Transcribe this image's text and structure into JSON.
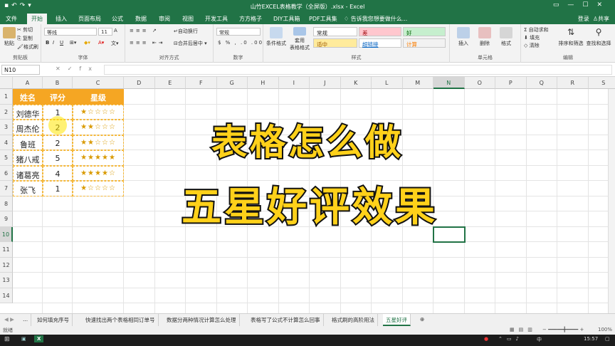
{
  "window": {
    "title": "山竹EXCEL表格教学（全屏版）.xlsx - Excel",
    "qat_icons": [
      "save-icon",
      "undo-icon",
      "redo-icon",
      "customize-icon"
    ]
  },
  "tabs": [
    "文件",
    "开始",
    "插入",
    "页面布局",
    "公式",
    "数据",
    "审阅",
    "视图",
    "开发工具",
    "方方格子",
    "DIY工具箱",
    "PDF工具集"
  ],
  "tell_me": "告诉我您想要做什么...",
  "account": {
    "login": "登录",
    "share": "共享"
  },
  "ribbon": {
    "clipboard": {
      "paste": "粘贴",
      "cut": "剪切",
      "copy": "复制",
      "format_painter": "格式刷",
      "label": "剪贴板"
    },
    "font": {
      "name": "等线",
      "size": "11",
      "bold": "B",
      "italic": "I",
      "underline": "U",
      "label": "字体"
    },
    "alignment": {
      "wrap": "自动换行",
      "merge": "合并后居中",
      "label": "对齐方式"
    },
    "number": {
      "format": "常规",
      "label": "数字"
    },
    "styles": {
      "conditional": "条件格式",
      "table": "套用\n表格格式",
      "cells": [
        {
          "text": "常规",
          "bg": "#ffffff",
          "color": "#222222"
        },
        {
          "text": "差",
          "bg": "#ffc7ce",
          "color": "#9c0006"
        },
        {
          "text": "好",
          "bg": "#c6efce",
          "color": "#006100"
        },
        {
          "text": "适中",
          "bg": "#ffeb9c",
          "color": "#9c5700"
        },
        {
          "text": "超链接",
          "bg": "#ffffff",
          "color": "#0563c1"
        },
        {
          "text": "计算",
          "bg": "#f2f2f2",
          "color": "#fa7d00"
        }
      ],
      "label": "样式"
    },
    "cells_group": {
      "insert": "插入",
      "delete": "删除",
      "format": "格式",
      "label": "单元格"
    },
    "editing": {
      "autosum": "自动求和",
      "fill": "填充",
      "clear": "清除",
      "sort": "排序和筛选",
      "find": "查找和选择",
      "label": "编辑"
    }
  },
  "formula_bar": {
    "name_box": "N10",
    "fx": "fx",
    "value": ""
  },
  "columns": [
    "A",
    "B",
    "C",
    "D",
    "E",
    "F",
    "G",
    "H",
    "I",
    "J",
    "K",
    "L",
    "M",
    "N",
    "O",
    "P",
    "Q",
    "R",
    "S"
  ],
  "rows": [
    "1",
    "2",
    "3",
    "4",
    "5",
    "6",
    "7",
    "8",
    "9",
    "10",
    "11",
    "12",
    "13",
    "14"
  ],
  "table": {
    "headers": [
      "姓名",
      "评分",
      "星级"
    ],
    "rows": [
      {
        "name": "刘德华",
        "score": "1",
        "stars": "★☆☆☆☆"
      },
      {
        "name": "周杰伦",
        "score": "2",
        "stars": "★★☆☆☆"
      },
      {
        "name": "鲁班",
        "score": "2",
        "stars": "★★☆☆☆"
      },
      {
        "name": "猪八戒",
        "score": "5",
        "stars": "★★★★★"
      },
      {
        "name": "诸葛亮",
        "score": "4",
        "stars": "★★★★☆"
      },
      {
        "name": "张飞",
        "score": "1",
        "stars": "★☆☆☆☆"
      }
    ]
  },
  "overlay": {
    "line1": "表格怎么做",
    "line2": "五星好评效果"
  },
  "sheet_tabs": [
    "...",
    "如何填充序号",
    "快速找出两个表格相同订单号",
    "数据分两种情况计算怎么处理",
    "表格写了公式不计算怎么回事",
    "格式刷的高阶用法",
    "五星好评"
  ],
  "active_sheet": "五星好评",
  "status": {
    "ready": "就绪",
    "zoom": "100%"
  },
  "taskbar": {
    "time": "15:57",
    "lang": "中"
  }
}
